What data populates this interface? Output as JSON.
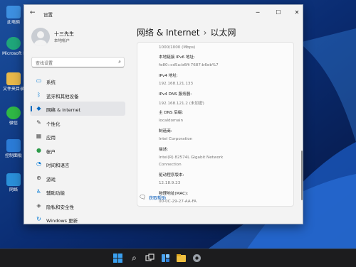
{
  "desktop": {
    "icons": [
      {
        "label": "此电脑",
        "color": "#3d8fe0"
      },
      {
        "label": "Microsoft Edge",
        "color": "#1fa67a"
      },
      {
        "label": "文件夹目录",
        "color": "#e8b84a"
      },
      {
        "label": "微信",
        "color": "#2fb845"
      },
      {
        "label": "控制面板",
        "color": "#2b7bd6"
      },
      {
        "label": "网络",
        "color": "#2a8fd8"
      }
    ]
  },
  "window": {
    "title": "设置",
    "controls": {
      "minimize": "─",
      "maximize": "☐",
      "close": "✕"
    }
  },
  "profile": {
    "name": "十三先生",
    "account_type": "本地帐户"
  },
  "search": {
    "placeholder": "查找设置"
  },
  "nav": {
    "items": [
      {
        "label": "系统",
        "icon": "display-icon",
        "glyph": "▭",
        "color": "#0078d4",
        "active": false
      },
      {
        "label": "蓝牙和其他设备",
        "icon": "bluetooth-icon",
        "glyph": "ᛒ",
        "color": "#0078d4",
        "active": false
      },
      {
        "label": "网络 & Internet",
        "icon": "wifi-icon",
        "glyph": "◆",
        "color": "#0067c0",
        "active": true
      },
      {
        "label": "个性化",
        "icon": "brush-icon",
        "glyph": "✎",
        "color": "#444444",
        "active": false
      },
      {
        "label": "应用",
        "icon": "apps-icon",
        "glyph": "▦",
        "color": "#555555",
        "active": false
      },
      {
        "label": "帐户",
        "icon": "person-icon",
        "glyph": "●",
        "color": "#2d9b4a",
        "active": false
      },
      {
        "label": "时间和语言",
        "icon": "globe-clock-icon",
        "glyph": "◔",
        "color": "#0078d4",
        "active": false
      },
      {
        "label": "游戏",
        "icon": "gamepad-icon",
        "glyph": "⊕",
        "color": "#555555",
        "active": false
      },
      {
        "label": "辅助功能",
        "icon": "accessibility-icon",
        "glyph": "♿",
        "color": "#0078d4",
        "active": false
      },
      {
        "label": "隐私和安全性",
        "icon": "shield-icon",
        "glyph": "◈",
        "color": "#666666",
        "active": false
      },
      {
        "label": "Windows 更新",
        "icon": "update-icon",
        "glyph": "↻",
        "color": "#0078d4",
        "active": false
      }
    ]
  },
  "breadcrumb": {
    "parent": "网络 & Internet",
    "separator": "›",
    "current": "以太网"
  },
  "properties": [
    {
      "key": "",
      "value": "1000/1000 (Mbps)"
    },
    {
      "key": "本地链接 IPv6 地址:",
      "value": "fe80::cd5a:b6ff:7687:b6eb%7"
    },
    {
      "key": "IPv4 地址:",
      "value": "192.168.121.133"
    },
    {
      "key": "IPv4 DNS 服务器:",
      "value": "192.168.121.2 (未加密)"
    },
    {
      "key": "主 DNS 后缀:",
      "value": "localdomain"
    },
    {
      "key": "制造商:",
      "value": "Intel Corporation"
    },
    {
      "key": "描述:",
      "value": "Intel(R) 82574L Gigabit Network"
    },
    {
      "key": "",
      "value": "Connection"
    },
    {
      "key": "驱动程序版本:",
      "value": "12.18.9.23"
    },
    {
      "key": "物理地址(MAC):",
      "value": "00-0C-29-27-AA-FA"
    }
  ],
  "help": {
    "label": "获取帮助"
  }
}
